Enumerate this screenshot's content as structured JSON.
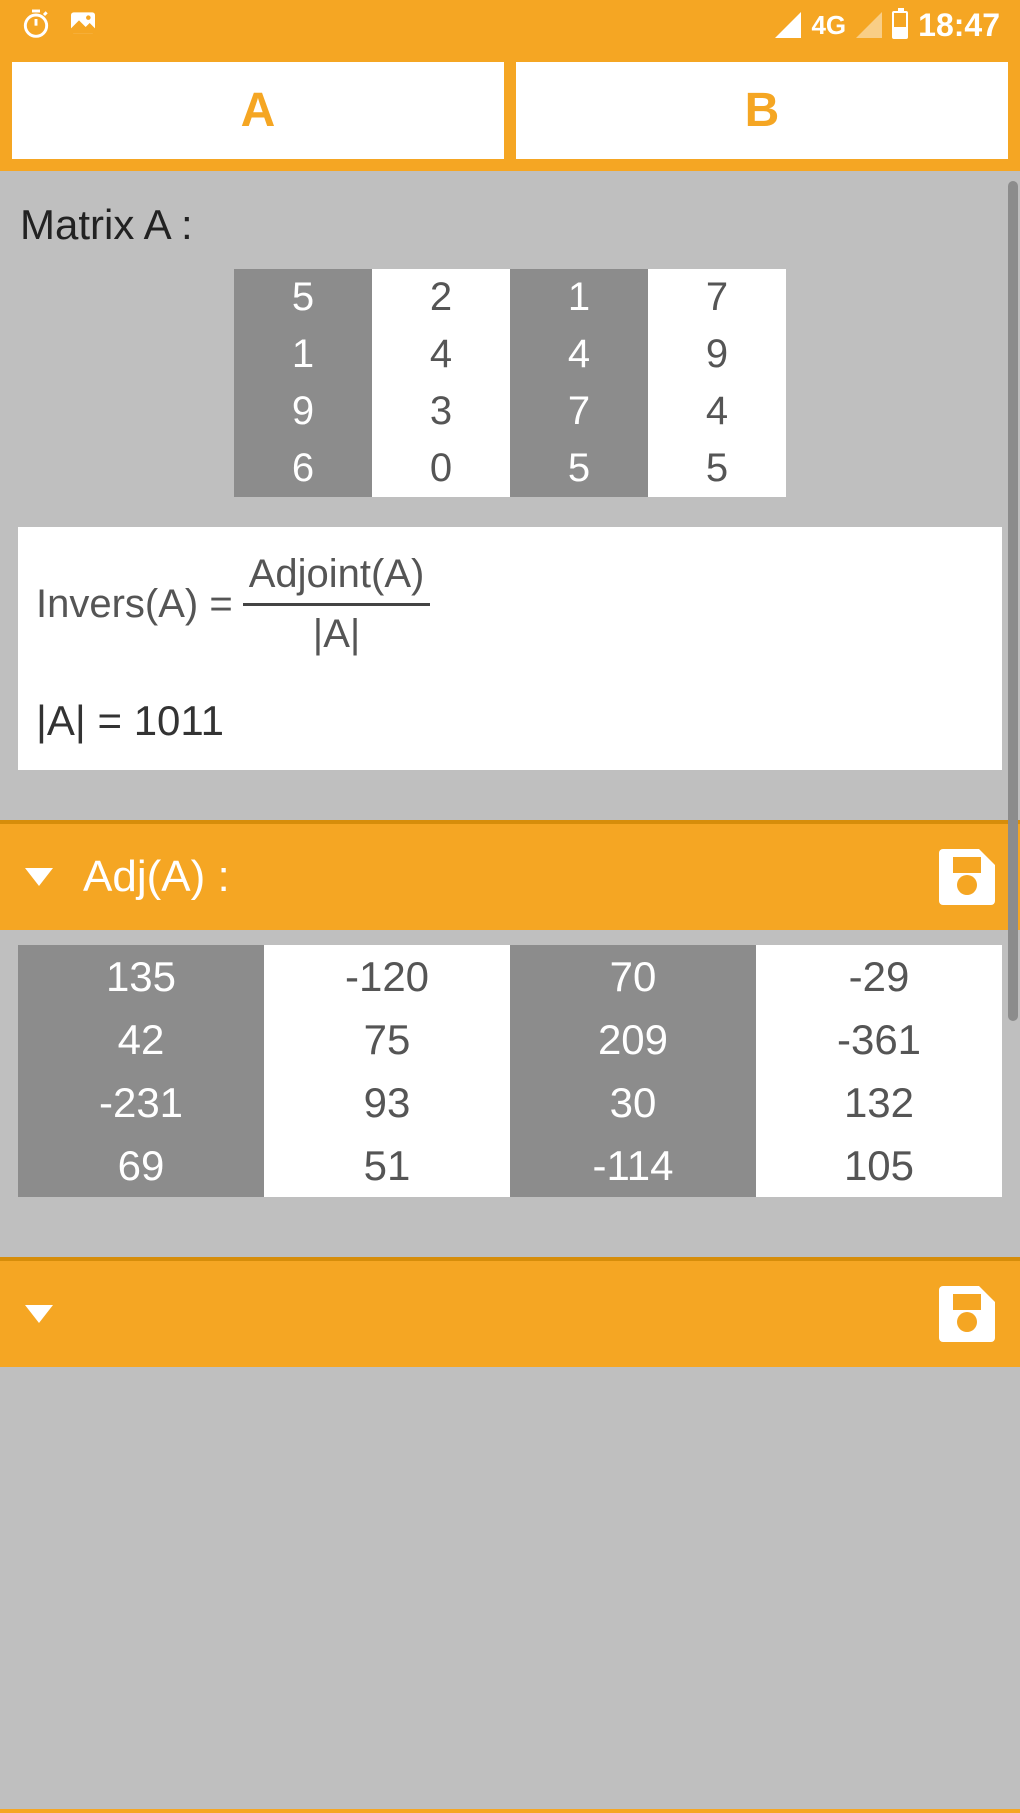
{
  "status": {
    "network_label": "4G",
    "time": "18:47"
  },
  "tabs": {
    "a": "A",
    "b": "B"
  },
  "matrix_a": {
    "label": "Matrix A :",
    "rows": [
      [
        "5",
        "2",
        "1",
        "7"
      ],
      [
        "1",
        "4",
        "4",
        "9"
      ],
      [
        "9",
        "3",
        "7",
        "4"
      ],
      [
        "6",
        "0",
        "5",
        "5"
      ]
    ]
  },
  "formula": {
    "lhs": "Invers(A)  = ",
    "top": "Adjoint(A)",
    "bot": "|A|",
    "det": "|A| = 1011"
  },
  "adj": {
    "title": "Adj(A) :",
    "rows": [
      [
        "135",
        "-120",
        "70",
        "-29"
      ],
      [
        "42",
        "75",
        "209",
        "-361"
      ],
      [
        "-231",
        "93",
        "30",
        "132"
      ],
      [
        "69",
        "51",
        "-114",
        "105"
      ]
    ]
  }
}
